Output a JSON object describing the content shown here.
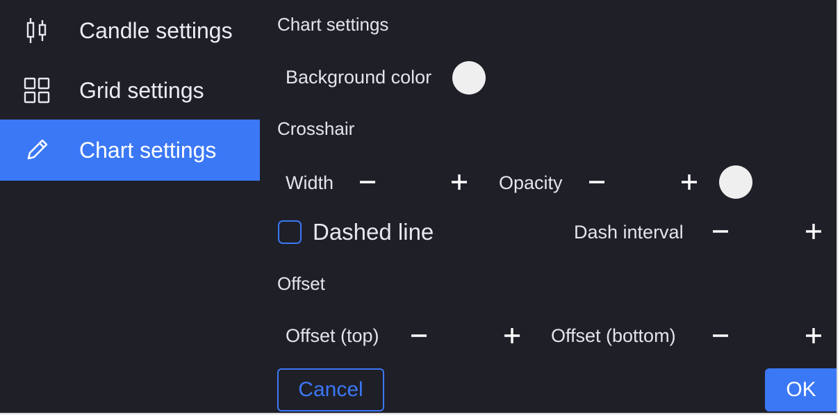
{
  "colors": {
    "panel_bg": "#1f1f28",
    "accent": "#3b78f5",
    "text": "#e4e4ea",
    "swatch_background": "#efefef",
    "swatch_crosshair": "#efefef"
  },
  "sidebar": {
    "items": [
      {
        "label": "Candle settings",
        "icon": "candlestick-icon",
        "active": false
      },
      {
        "label": "Grid settings",
        "icon": "grid-icon",
        "active": false
      },
      {
        "label": "Chart settings",
        "icon": "pencil-icon",
        "active": true
      }
    ]
  },
  "main": {
    "title": "Chart settings",
    "background_color_label": "Background color",
    "crosshair": {
      "title": "Crosshair",
      "width_label": "Width",
      "opacity_label": "Opacity",
      "dashed_line_label": "Dashed line",
      "dashed_line_checked": false,
      "dash_interval_label": "Dash interval"
    },
    "offset": {
      "title": "Offset",
      "top_label": "Offset (top)",
      "bottom_label": "Offset (bottom)"
    },
    "controls": {
      "minus_glyph": "–",
      "plus_glyph": "+"
    }
  },
  "footer": {
    "cancel_label": "Cancel",
    "ok_label": "OK"
  }
}
